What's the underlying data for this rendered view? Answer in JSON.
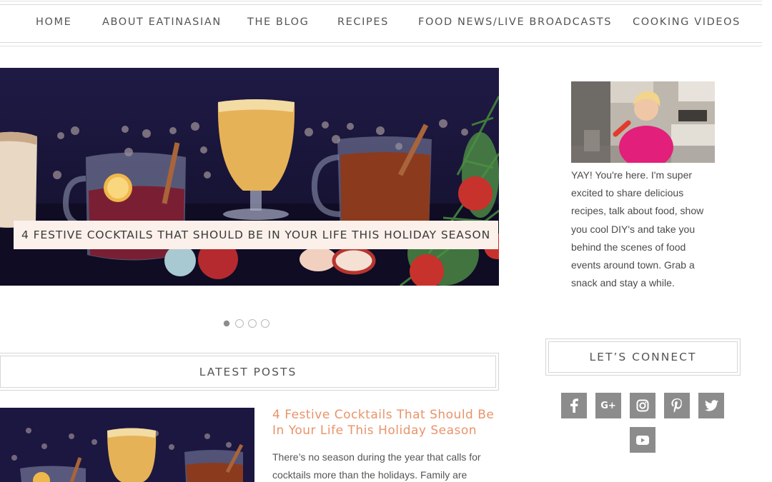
{
  "nav": {
    "items": [
      {
        "label": "HOME"
      },
      {
        "label": "ABOUT EATINASIAN"
      },
      {
        "label": "THE BLOG"
      },
      {
        "label": "RECIPES"
      },
      {
        "label": "FOOD NEWS/LIVE BROADCASTS"
      },
      {
        "label": "COOKING VIDEOS"
      }
    ]
  },
  "slider": {
    "caption": "4 FESTIVE COCKTAILS THAT SHOULD BE IN YOUR LIFE THIS HOLIDAY SEASON",
    "slide_count": 4,
    "active_slide": 1
  },
  "latest": {
    "heading": "LATEST POSTS",
    "post": {
      "title": "4 Festive Cocktails That Should Be In Your Life This Holiday Season",
      "excerpt": "There’s no season during the year that calls for cocktails more than the holidays. Family are"
    }
  },
  "sidebar": {
    "bio": "YAY! You're here. I'm super excited to share delicious recipes, talk about food, show you cool DIY's and take you behind the scenes of food events around town. Grab a snack and stay a while.",
    "connect_heading": "LET’S CONNECT",
    "social": [
      {
        "icon": "facebook-icon"
      },
      {
        "icon": "google-plus-icon",
        "text": "G+"
      },
      {
        "icon": "instagram-icon"
      },
      {
        "icon": "pinterest-icon"
      },
      {
        "icon": "twitter-icon"
      },
      {
        "icon": "youtube-icon"
      }
    ]
  },
  "colors": {
    "accent": "#e9936a",
    "social_bg": "#8c8c8c",
    "slider_bg": "#181435",
    "caption_bg": "#fbf0ea"
  }
}
